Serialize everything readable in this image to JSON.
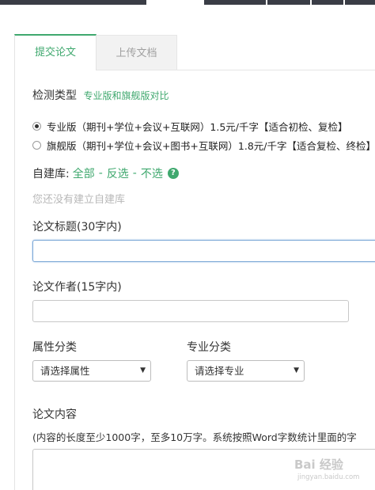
{
  "tabs": [
    {
      "label": "提交论文",
      "active": true
    },
    {
      "label": "上传文档",
      "active": false
    }
  ],
  "detect": {
    "title": "检测类型",
    "compare_link": "专业版和旗舰版对比",
    "options": [
      {
        "label": "专业版（期刊+学位+会议+互联网）1.5元/千字【适合初检、复检】",
        "checked": true
      },
      {
        "label": "旗舰版（期刊+学位+会议+图书+互联网）1.8元/千字【适合复检、终检】",
        "checked": false
      }
    ]
  },
  "library": {
    "label": "自建库:",
    "select_all": "全部",
    "sep1": "-",
    "invert": "反选",
    "sep2": "-",
    "select_none": "不选",
    "help_glyph": "?",
    "help_icon": "question-circle-icon",
    "empty_hint": "您还没有建立自建库"
  },
  "paper_title": {
    "label": "论文标题(30字内)",
    "value": ""
  },
  "paper_author": {
    "label": "论文作者(15字内)",
    "value": ""
  },
  "attribute": {
    "label": "属性分类",
    "selected": "请选择属性"
  },
  "major": {
    "label": "专业分类",
    "selected": "请选择专业"
  },
  "content": {
    "label": "论文内容",
    "note": "(内容的长度至少1000字，至多10万字。系统按照Word字数统计里面的字"
  },
  "watermark": {
    "text": "Bai 经验",
    "sub": "jingyan.baidu.com"
  },
  "colors": {
    "accent": "#3fa86e",
    "tab_inactive_bg": "#f2f2f2",
    "focus_border": "#7aa7d6"
  }
}
